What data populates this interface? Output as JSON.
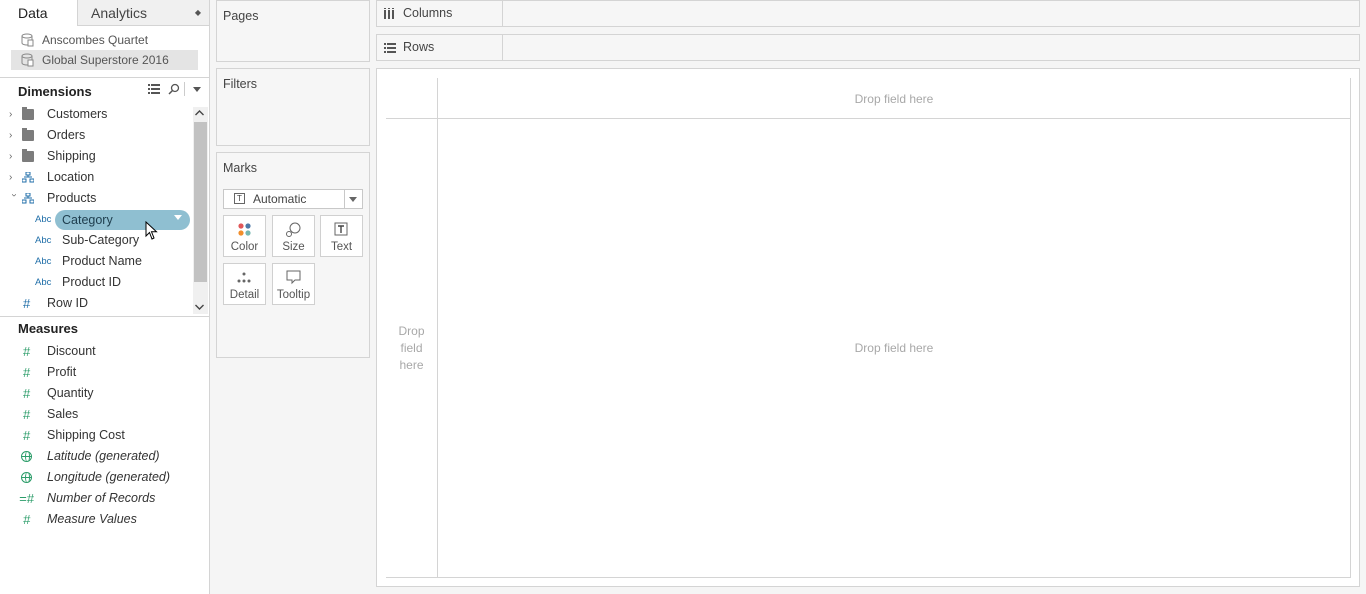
{
  "tabs": {
    "data": "Data",
    "analytics": "Analytics"
  },
  "datasources": [
    {
      "name": "Anscombes Quartet"
    },
    {
      "name": "Global Superstore 2016"
    }
  ],
  "dimensions": {
    "title": "Dimensions",
    "items": [
      {
        "label": "Customers"
      },
      {
        "label": "Orders"
      },
      {
        "label": "Shipping"
      },
      {
        "label": "Location"
      },
      {
        "label": "Products"
      },
      {
        "label": "Category",
        "type_label": "Abc"
      },
      {
        "label": "Sub-Category",
        "type_label": "Abc"
      },
      {
        "label": "Product Name",
        "type_label": "Abc"
      },
      {
        "label": "Product ID",
        "type_label": "Abc"
      },
      {
        "label": "Row ID"
      }
    ]
  },
  "measures": {
    "title": "Measures",
    "items": [
      {
        "label": "Discount"
      },
      {
        "label": "Profit"
      },
      {
        "label": "Quantity"
      },
      {
        "label": "Sales"
      },
      {
        "label": "Shipping Cost"
      },
      {
        "label": "Latitude (generated)"
      },
      {
        "label": "Longitude (generated)"
      },
      {
        "label": "Number of Records"
      },
      {
        "label": "Measure Values"
      }
    ]
  },
  "cards": {
    "pages": "Pages",
    "filters": "Filters",
    "marks": "Marks",
    "mark_type": "Automatic",
    "mark_type_icon": "T",
    "buttons": {
      "color": "Color",
      "size": "Size",
      "text": "Text",
      "detail": "Detail",
      "tooltip": "Tooltip"
    }
  },
  "shelves": {
    "columns": "Columns",
    "rows": "Rows"
  },
  "canvas": {
    "drop_top": "Drop field here",
    "drop_left": [
      "Drop",
      "field",
      "here"
    ],
    "drop_center": "Drop field here"
  },
  "colors": {
    "pill": "#8fbfd1",
    "dimension_icon": "#1f6ea8",
    "measure_icon": "#2c9d6a"
  }
}
